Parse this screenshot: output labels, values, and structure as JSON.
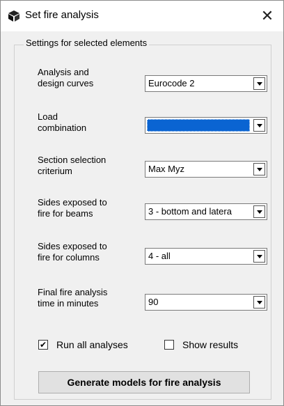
{
  "window": {
    "title": "Set fire analysis",
    "close_icon": "close-icon"
  },
  "group": {
    "legend": "Settings for selected elements"
  },
  "fields": [
    {
      "label": "Analysis and\ndesign curves",
      "value": "Eurocode 2"
    },
    {
      "label": "Load\ncombination",
      "value": ""
    },
    {
      "label": "Section selection\ncriterium",
      "value": "Max Myz"
    },
    {
      "label": "Sides exposed to\nfire for beams",
      "value": "3 - bottom and latera"
    },
    {
      "label": "Sides exposed to\nfire for columns",
      "value": "4 - all"
    },
    {
      "label": "Final fire analysis\ntime in minutes",
      "value": "90"
    }
  ],
  "options": {
    "run_all": {
      "label": "Run all analyses",
      "checked": true
    },
    "show_results": {
      "label": "Show results",
      "checked": false
    }
  },
  "button": {
    "generate": "Generate models for fire analysis"
  },
  "colors": {
    "selection": "#0a64d2"
  }
}
